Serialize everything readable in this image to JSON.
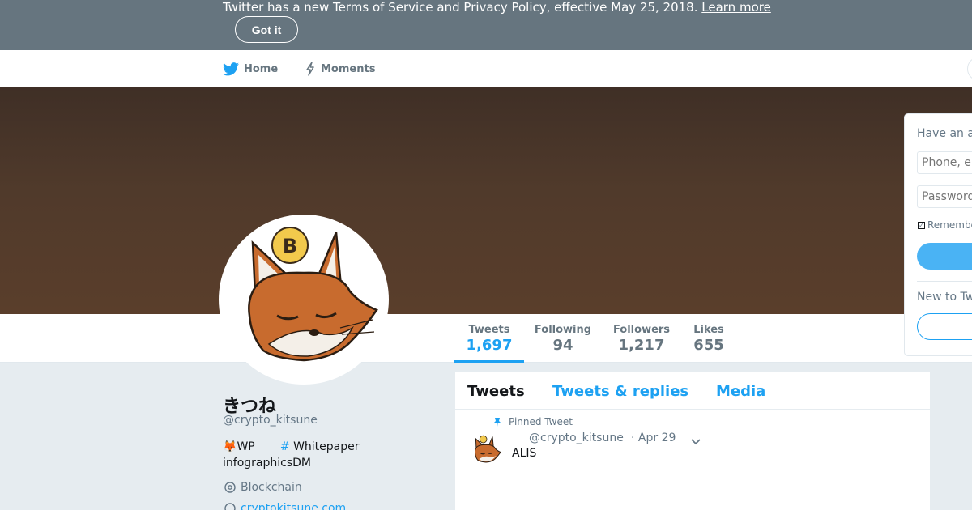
{
  "banner": {
    "text": "Twitter has a new Terms of Service and Privacy Policy, effective May 25, 2018.",
    "link": "Learn more",
    "button": "Got it"
  },
  "nav": {
    "home": "Home",
    "moments": "Moments"
  },
  "profile": {
    "name": "きつね",
    "handle": "@crypto_kitsune",
    "bio_line1_emoji": "🦊",
    "bio_wp": "WP",
    "bio_hash": "#",
    "bio_whitepaper": "Whitepaper",
    "bio_line2": "infographicsDM",
    "location": "Blockchain",
    "url": "cryptokitsune.com"
  },
  "stats": [
    {
      "label": "Tweets",
      "value": "1,697"
    },
    {
      "label": "Following",
      "value": "94"
    },
    {
      "label": "Followers",
      "value": "1,217"
    },
    {
      "label": "Likes",
      "value": "655"
    }
  ],
  "timeline": {
    "tabs": [
      "Tweets",
      "Tweets & replies",
      "Media"
    ],
    "pinned_label": "Pinned Tweet",
    "tweet": {
      "handle": "@crypto_kitsune",
      "time": "· Apr 29",
      "text": "ALIS"
    }
  },
  "login": {
    "title": "Have an account?",
    "phone_placeholder": "Phone, email or username",
    "password_placeholder": "Password",
    "remember": "Remember me",
    "new_title": "New to Twitter?"
  },
  "colors": {
    "accent": "#1da1f2",
    "banner_bg": "#66757f",
    "page_bg": "#e6ecf0"
  }
}
